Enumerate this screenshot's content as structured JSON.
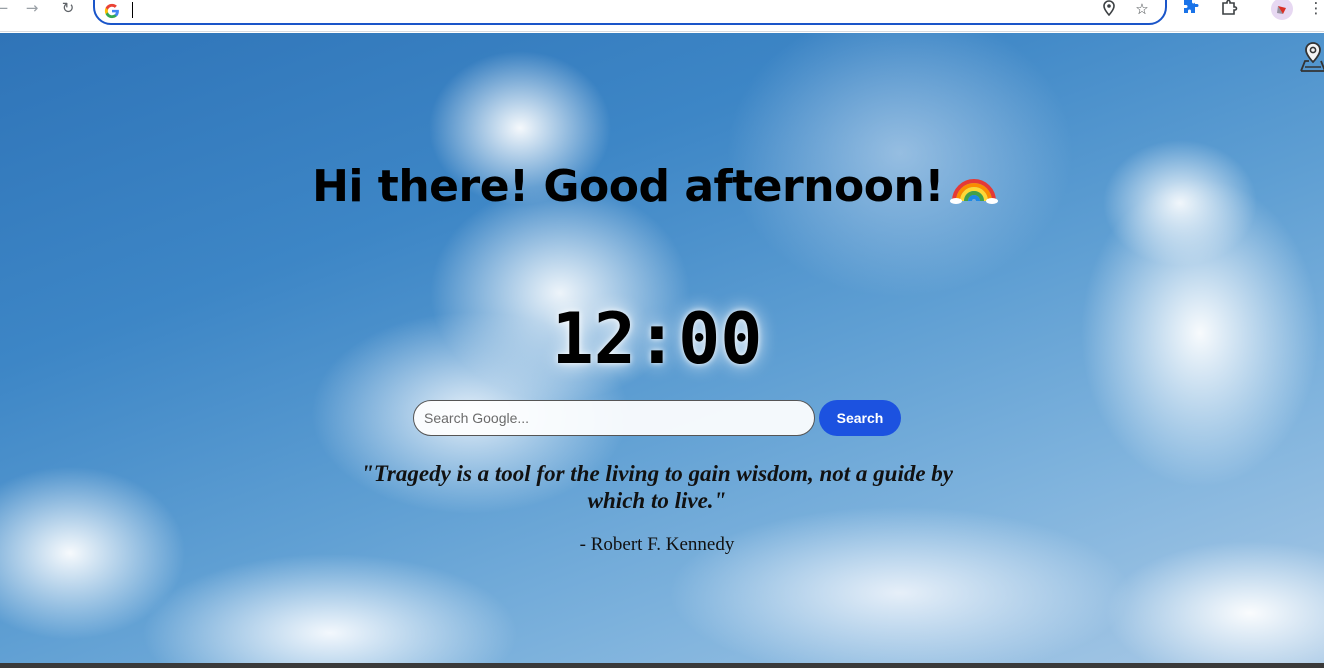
{
  "browser": {
    "address_value": "",
    "icons": {
      "back": "back-arrow-icon",
      "forward": "forward-arrow-icon",
      "reload": "reload-icon",
      "site": "google-g-icon",
      "location": "location-pin-icon",
      "bookmark": "star-icon",
      "extension": "extension-icon",
      "extensions_menu": "puzzle-icon",
      "profile": "profile-avatar",
      "menu": "kebab-menu-icon"
    },
    "omnibox_border_color": "#1a55c9"
  },
  "page": {
    "greeting": "Hi there! Good afternoon!",
    "greeting_emoji": "rainbow",
    "clock": "12:00",
    "search": {
      "placeholder": "Search Google...",
      "button_label": "Search",
      "button_color": "#1c52e0"
    },
    "quote": {
      "text": "\"Tragedy is a tool for the living to gain wisdom, not a guide by which to live.\"",
      "author": "- Robert F. Kennedy"
    },
    "map_icon": "map-pin-icon",
    "background": "sky-clouds"
  }
}
